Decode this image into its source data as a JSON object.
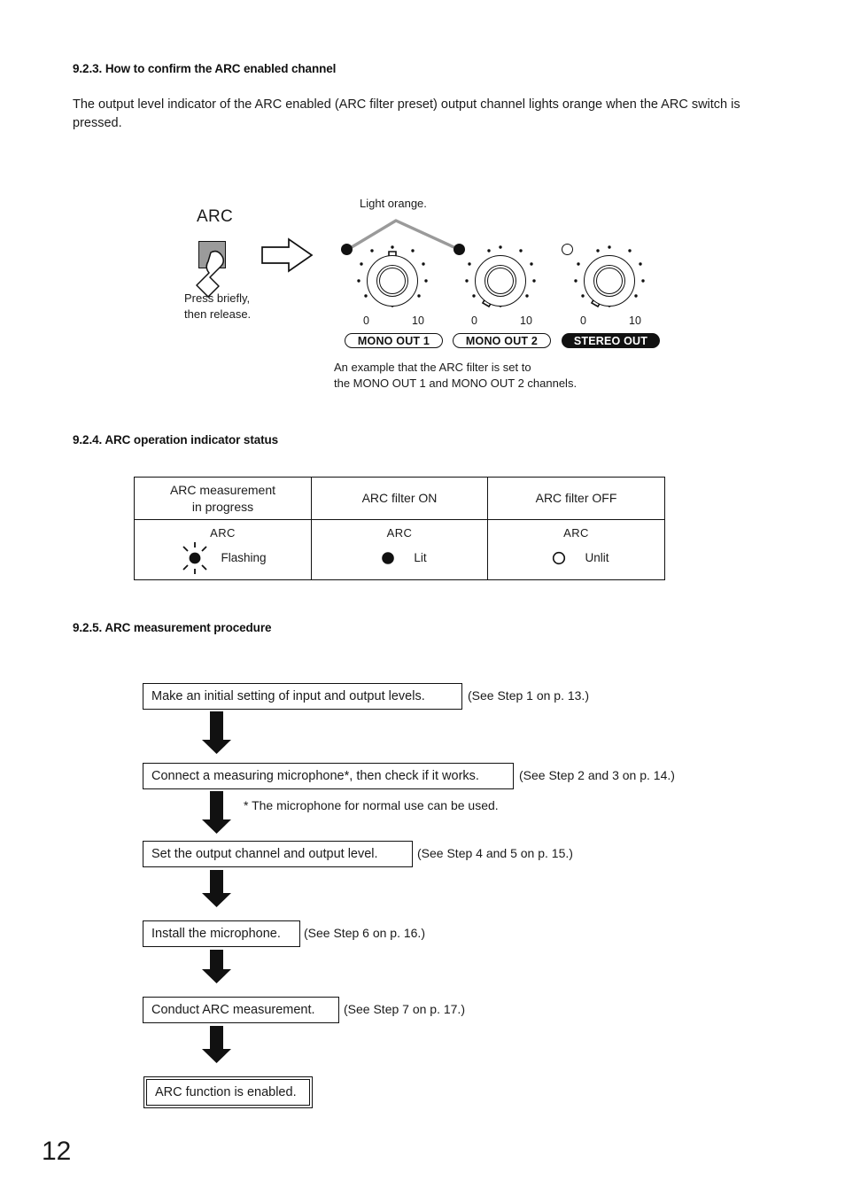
{
  "page": {
    "number": "12"
  },
  "section_923": {
    "heading": "9.2.3. How to confirm the ARC enabled channel",
    "paragraph": "The output level indicator of the ARC enabled (ARC filter preset) output channel lights orange when the ARC switch is pressed.",
    "figure": {
      "arc_label": "ARC",
      "press_note_line1": "Press briefly,",
      "press_note_line2": "then release.",
      "callout": "Light orange.",
      "channels": [
        {
          "name": "MONO OUT 1",
          "style": "outline",
          "indicator": "on",
          "scale_min": "0",
          "scale_max": "10"
        },
        {
          "name": "MONO OUT 2",
          "style": "outline",
          "indicator": "on",
          "scale_min": "0",
          "scale_max": "10"
        },
        {
          "name": "STEREO OUT",
          "style": "filled",
          "indicator": "off",
          "scale_min": "0",
          "scale_max": "10"
        }
      ],
      "caption_line1": "An example that the ARC filter is set to",
      "caption_line2": "the MONO OUT 1 and MONO OUT 2 channels."
    }
  },
  "section_924": {
    "heading": "9.2.4. ARC operation indicator status",
    "table": {
      "headers": [
        "ARC measurement\nin progress",
        "ARC filter ON",
        "ARC filter OFF"
      ],
      "header_line1": [
        "ARC measurement",
        "ARC filter ON",
        "ARC filter OFF"
      ],
      "header_line2": [
        "in progress",
        "",
        ""
      ],
      "cells": [
        {
          "led_label": "ARC",
          "state_label": "Flashing",
          "indicator": "flashing"
        },
        {
          "led_label": "ARC",
          "state_label": "Lit",
          "indicator": "lit"
        },
        {
          "led_label": "ARC",
          "state_label": "Unlit",
          "indicator": "unlit"
        }
      ]
    }
  },
  "section_925": {
    "heading": "9.2.5. ARC measurement procedure",
    "steps": [
      {
        "box": "Make an initial setting of input and output levels.",
        "ref": "(See Step 1 on p. 13.)"
      },
      {
        "box": "Connect a measuring microphone*, then check if it works.",
        "ref": "(See Step 2 and 3 on p. 14.)"
      },
      {
        "box": "Set the output channel and output level.",
        "ref": "(See Step 4 and 5 on p. 15.)"
      },
      {
        "box": "Install the microphone.",
        "ref": "(See Step 6 on p. 16.)"
      },
      {
        "box": "Conduct ARC measurement.",
        "ref": "(See Step 7 on p. 17.)"
      },
      {
        "box": "ARC function is enabled.",
        "ref": ""
      }
    ],
    "footnote": "* The microphone for normal use can be used."
  },
  "colors": {
    "ink": "#1a1a1a",
    "button_gray": "#9b9b9b",
    "leader_gray": "#9a9a9a"
  }
}
